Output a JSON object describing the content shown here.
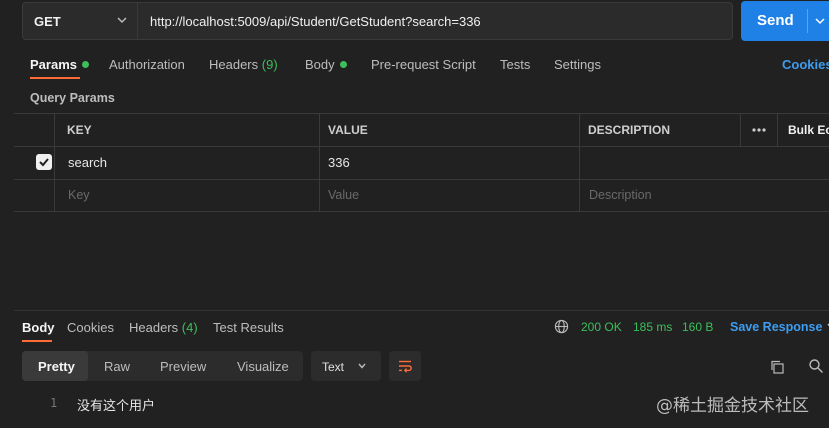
{
  "request": {
    "method": "GET",
    "url": "http://localhost:5009/api/Student/GetStudent?search=336",
    "send_label": "Send"
  },
  "request_tabs": {
    "params": "Params",
    "authorization": "Authorization",
    "headers": "Headers",
    "headers_count": "(9)",
    "body": "Body",
    "prerequest": "Pre-request Script",
    "tests": "Tests",
    "settings": "Settings",
    "cookies": "Cookies"
  },
  "query_params": {
    "title": "Query Params",
    "columns": {
      "key": "KEY",
      "value": "VALUE",
      "description": "DESCRIPTION",
      "bulk_edit": "Bulk Ec"
    },
    "rows": [
      {
        "checked": true,
        "key": "search",
        "value": "336",
        "description": ""
      }
    ],
    "placeholders": {
      "key": "Key",
      "value": "Value",
      "description": "Description"
    }
  },
  "response_tabs": {
    "body": "Body",
    "cookies": "Cookies",
    "headers": "Headers",
    "headers_count": "(4)",
    "test_results": "Test Results"
  },
  "response_status": {
    "status": "200 OK",
    "time": "185 ms",
    "size": "160 B",
    "save_response": "Save Response"
  },
  "response_view": {
    "modes": [
      "Pretty",
      "Raw",
      "Preview",
      "Visualize"
    ],
    "active_mode": "Pretty",
    "format": "Text",
    "lines": [
      {
        "number": "1",
        "text": "没有这个用户"
      }
    ]
  },
  "watermark": "@稀土掘金技术社区",
  "colors": {
    "accent_orange": "#ff6c37",
    "send_blue": "#1f80e6",
    "success_green": "#3cbf5b",
    "link_blue": "#3d9df0"
  }
}
